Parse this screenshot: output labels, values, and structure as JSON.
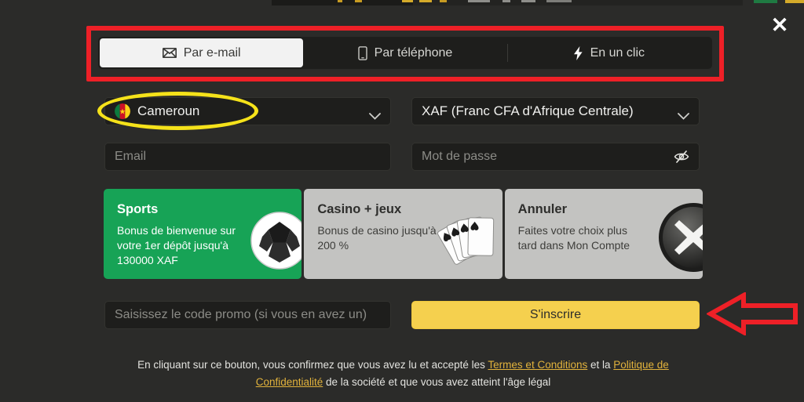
{
  "window": {
    "title": "Registration modal",
    "close_label": "✕",
    "background_color": "#2b2b29"
  },
  "tabs": [
    {
      "id": "email",
      "label": "Par e-mail",
      "icon": "envelope-icon",
      "active": true
    },
    {
      "id": "phone",
      "label": "Par téléphone",
      "icon": "phone-icon",
      "active": false
    },
    {
      "id": "one_click",
      "label": "En un clic",
      "icon": "lightning-icon",
      "active": false
    }
  ],
  "country_select": {
    "value": "Cameroun",
    "flag": "cameroon-flag-icon",
    "chevron": "chevron-down-icon"
  },
  "currency_select": {
    "value": "XAF (Franc CFA d'Afrique Centrale)",
    "chevron": "chevron-down-icon"
  },
  "email_field": {
    "placeholder": "Email",
    "value": ""
  },
  "password_field": {
    "placeholder": "Mot de passe",
    "value": "",
    "toggle_icon": "eye-slash-icon"
  },
  "bonus_cards": [
    {
      "id": "sports",
      "title": "Sports",
      "description": "Bonus de bienvenue sur votre 1er dépôt jusqu'à 130000 XAF",
      "art": "football-icon",
      "selected": true,
      "bg_color": "#17a356"
    },
    {
      "id": "casino",
      "title": "Casino + jeux",
      "description": "Bonus de casino jusqu'à 200 %",
      "art": "playing-cards-icon",
      "selected": false,
      "bg_color": "#c3c3c1"
    },
    {
      "id": "cancel",
      "title": "Annuler",
      "description": "Faites votre choix plus tard dans Mon Compte",
      "art": "x-button-icon",
      "selected": false,
      "bg_color": "#c3c3c1"
    }
  ],
  "promo_field": {
    "placeholder": "Saisissez le code promo (si vous en avez un)",
    "value": ""
  },
  "submit_button": {
    "label": "S'inscrire",
    "color": "#f5d04e"
  },
  "footer": {
    "part1": "En cliquant sur ce bouton, vous confirmez que vous avez lu et accepté les ",
    "link1": "Termes et Conditions",
    "part2": " et la ",
    "link2": "Politique de Confidentialité",
    "part3": " de la société et que vous avez atteint l'âge légal",
    "link_color": "#e2b33c"
  },
  "annotations": {
    "tabs_highlight_color": "#ee2027",
    "country_highlight_color": "#f5e21a",
    "arrow_color": "#ee2027",
    "arrow_direction": "left"
  }
}
